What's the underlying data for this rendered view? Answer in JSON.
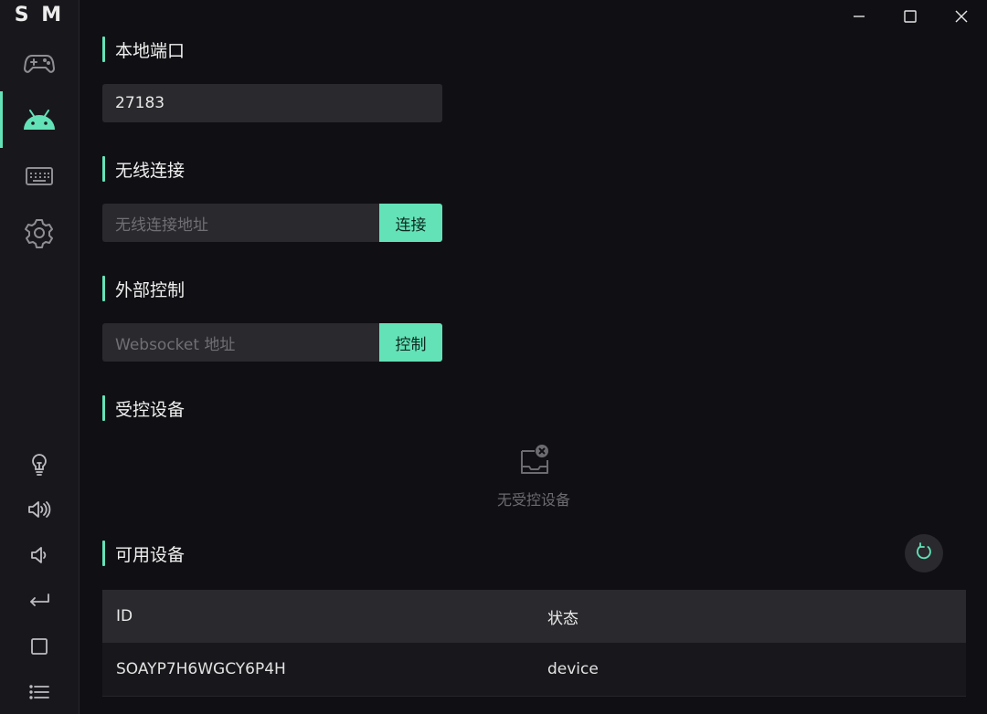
{
  "app": {
    "logo": "S M"
  },
  "sidebar": {
    "nav": [
      {
        "icon": "gamepad-icon",
        "active": false
      },
      {
        "icon": "android-icon",
        "active": true
      },
      {
        "icon": "keyboard-icon",
        "active": false
      },
      {
        "icon": "gear-icon",
        "active": false
      }
    ],
    "tools": [
      {
        "icon": "lightbulb-icon"
      },
      {
        "icon": "volume-up-icon"
      },
      {
        "icon": "volume-down-icon"
      },
      {
        "icon": "back-icon"
      },
      {
        "icon": "home-square-icon"
      },
      {
        "icon": "menu-list-icon"
      }
    ]
  },
  "window_controls": {
    "minimize": "minimize-icon",
    "maximize": "maximize-icon",
    "close": "close-icon"
  },
  "local_port": {
    "title": "本地端口",
    "value": "27183"
  },
  "wireless": {
    "title": "无线连接",
    "placeholder": "无线连接地址",
    "button": "连接"
  },
  "external": {
    "title": "外部控制",
    "placeholder": "Websocket 地址",
    "button": "控制"
  },
  "controlled": {
    "title": "受控设备",
    "empty_text": "无受控设备",
    "empty_icon": "no-device-icon"
  },
  "available": {
    "title": "可用设备",
    "refresh_icon": "refresh-icon",
    "columns": [
      "ID",
      "状态"
    ],
    "rows": [
      {
        "id": "SOAYP7H6WGCY6P4H",
        "status": "device"
      }
    ]
  },
  "colors": {
    "accent": "#63e2b7",
    "background": "#101014",
    "sidebar": "#18181c",
    "input": "#2a2a2e"
  }
}
